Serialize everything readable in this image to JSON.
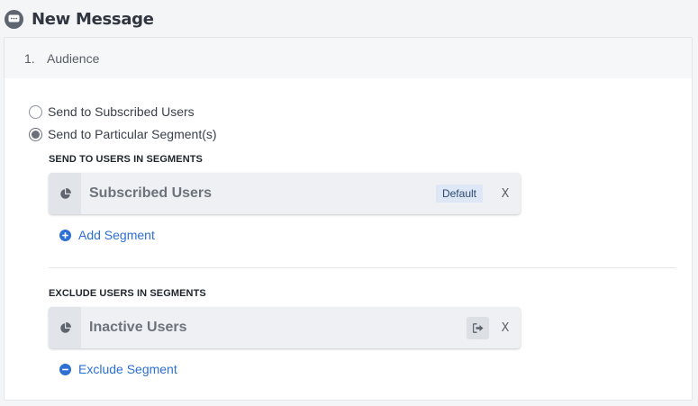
{
  "header": {
    "title": "New Message",
    "icon": "chat-bubble-icon"
  },
  "step": {
    "number": "1.",
    "title": "Audience"
  },
  "audience_options": [
    {
      "label": "Send to Subscribed Users",
      "checked": false
    },
    {
      "label": "Send to Particular Segment(s)",
      "checked": true
    }
  ],
  "send_section": {
    "label": "SEND TO USERS IN SEGMENTS",
    "segment": {
      "name": "Subscribed Users",
      "badge": "Default",
      "remove": "X"
    },
    "add_link": "Add Segment"
  },
  "exclude_section": {
    "label": "EXCLUDE USERS IN SEGMENTS",
    "segment": {
      "name": "Inactive Users",
      "remove": "X"
    },
    "add_link": "Exclude Segment"
  },
  "colors": {
    "accent": "#2d6fd2",
    "chip_bg": "#eef0f3",
    "badge_bg": "#dde7f5"
  }
}
